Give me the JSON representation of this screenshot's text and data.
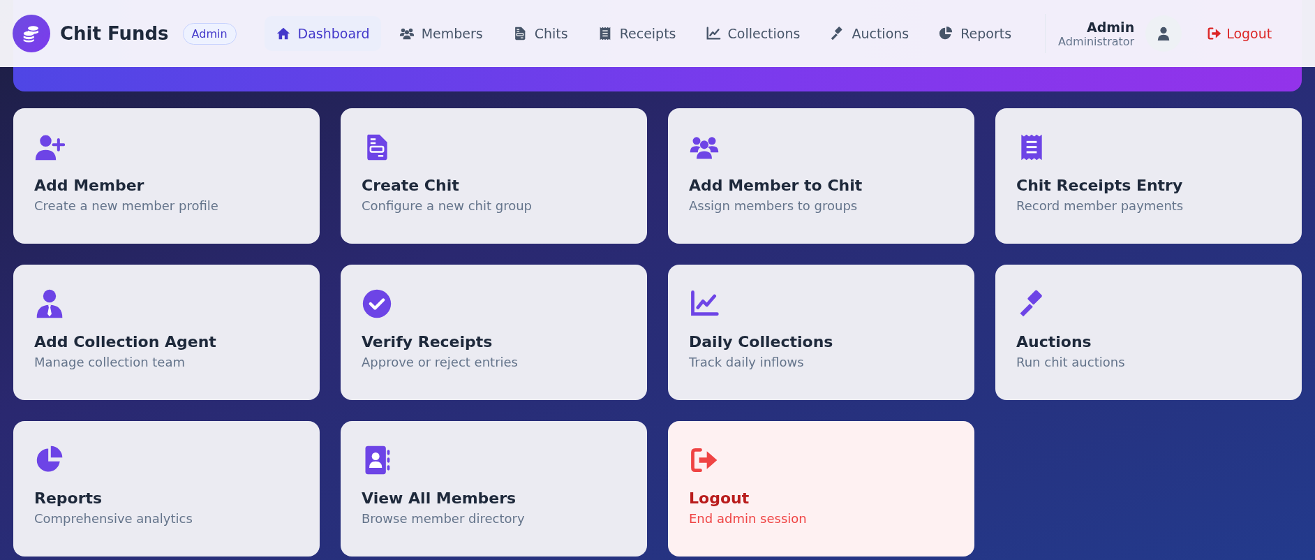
{
  "brand": {
    "name": "Chit Funds",
    "badge": "Admin"
  },
  "nav": [
    {
      "label": "Dashboard",
      "selected": true
    },
    {
      "label": "Members",
      "selected": false
    },
    {
      "label": "Chits",
      "selected": false
    },
    {
      "label": "Receipts",
      "selected": false
    },
    {
      "label": "Collections",
      "selected": false
    },
    {
      "label": "Auctions",
      "selected": false
    },
    {
      "label": "Reports",
      "selected": false
    }
  ],
  "user": {
    "name": "Admin",
    "role": "Administrator"
  },
  "logout": "Logout",
  "cards": [
    {
      "kind": "action",
      "title": "Add Member",
      "subtitle": "Create a new member profile"
    },
    {
      "kind": "action",
      "title": "Create Chit",
      "subtitle": "Configure a new chit group"
    },
    {
      "kind": "action",
      "title": "Add Member to Chit",
      "subtitle": "Assign members to groups"
    },
    {
      "kind": "action",
      "title": "Chit Receipts Entry",
      "subtitle": "Record member payments"
    },
    {
      "kind": "action",
      "title": "Add Collection Agent",
      "subtitle": "Manage collection team"
    },
    {
      "kind": "action",
      "title": "Verify Receipts",
      "subtitle": "Approve or reject entries"
    },
    {
      "kind": "action",
      "title": "Daily Collections",
      "subtitle": "Track daily inflows"
    },
    {
      "kind": "action",
      "title": "Auctions",
      "subtitle": "Run chit auctions"
    },
    {
      "kind": "action",
      "title": "Reports",
      "subtitle": "Comprehensive analytics"
    },
    {
      "kind": "action",
      "title": "View All Members",
      "subtitle": "Browse member directory"
    },
    {
      "kind": "danger",
      "title": "Logout",
      "subtitle": "End admin session"
    }
  ]
}
